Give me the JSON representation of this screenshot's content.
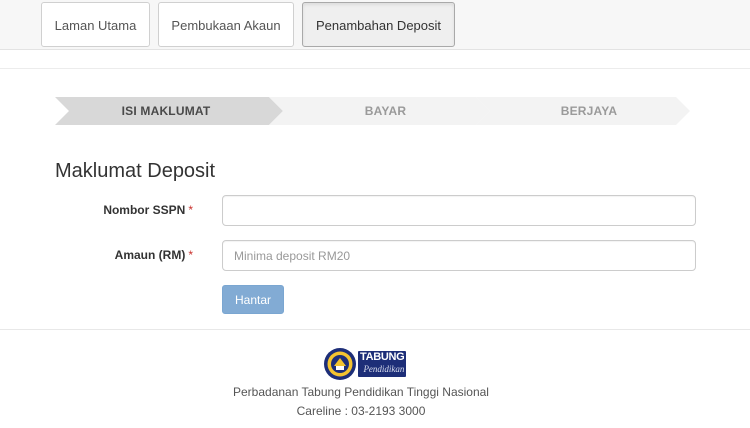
{
  "nav": {
    "tabs": [
      {
        "label": "Laman Utama",
        "active": false
      },
      {
        "label": "Pembukaan Akaun",
        "active": false
      },
      {
        "label": "Penambahan Deposit",
        "active": true
      }
    ]
  },
  "steps": [
    {
      "label": "ISI MAKLUMAT",
      "active": true
    },
    {
      "label": "BAYAR",
      "active": false
    },
    {
      "label": "BERJAYA",
      "active": false
    }
  ],
  "form": {
    "title": "Maklumat Deposit",
    "required_marker": "*",
    "fields": [
      {
        "label": "Nombor SSPN",
        "value": "",
        "placeholder": ""
      },
      {
        "label": "Amaun (RM)",
        "value": "",
        "placeholder": "Minima deposit RM20"
      }
    ],
    "submit_label": "Hantar"
  },
  "footer": {
    "logo_word": "TABUNG",
    "logo_sub": "Pendidikan",
    "org_name": "Perbadanan Tabung Pendidikan Tinggi Nasional",
    "careline": "Careline : 03-2193 3000"
  },
  "colors": {
    "step_active": "#d8d8d8",
    "step_inactive": "#f3f3f3",
    "primary_button": "#82abd4",
    "required": "#c9302c",
    "logo_blue": "#1d2e78"
  }
}
